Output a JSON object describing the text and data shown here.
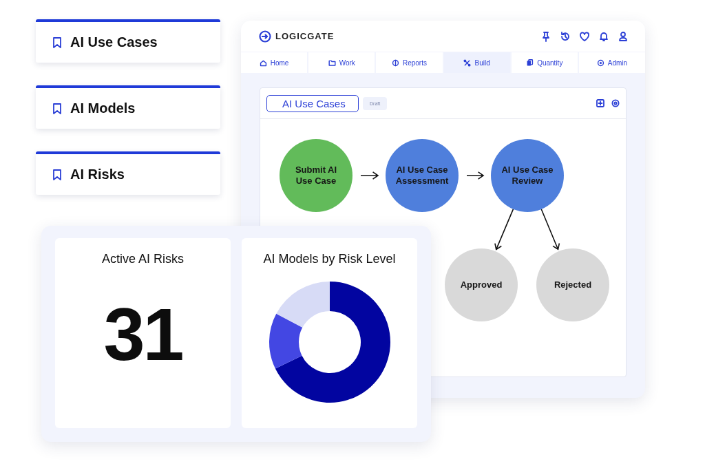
{
  "side_cards": [
    {
      "label": "AI Use Cases"
    },
    {
      "label": "AI Models"
    },
    {
      "label": "AI Risks"
    }
  ],
  "app": {
    "logo": "LOGICGATE",
    "tabs": [
      {
        "label": "Home",
        "selected": false
      },
      {
        "label": "Work",
        "selected": false
      },
      {
        "label": "Reports",
        "selected": false
      },
      {
        "label": "Build",
        "selected": true
      },
      {
        "label": "Quantity",
        "selected": false
      },
      {
        "label": "Admin",
        "selected": false
      }
    ]
  },
  "workflow": {
    "title": "AI Use Cases",
    "status": "Draft",
    "nodes": [
      {
        "label": "Submit AI Use Case",
        "color": "#62bb5a"
      },
      {
        "label": "AI Use Case Assessment",
        "color": "#4f7fdc"
      },
      {
        "label": "AI Use Case Review",
        "color": "#4f7fdc"
      },
      {
        "label": "Approved",
        "color": "#d9d9d9"
      },
      {
        "label": "Rejected",
        "color": "#d9d9d9"
      }
    ]
  },
  "dashboard": {
    "cards": [
      {
        "kind": "metric",
        "title": "Active AI Risks",
        "value": "31"
      },
      {
        "kind": "donut",
        "title": "AI Models by Risk Level"
      }
    ]
  }
}
